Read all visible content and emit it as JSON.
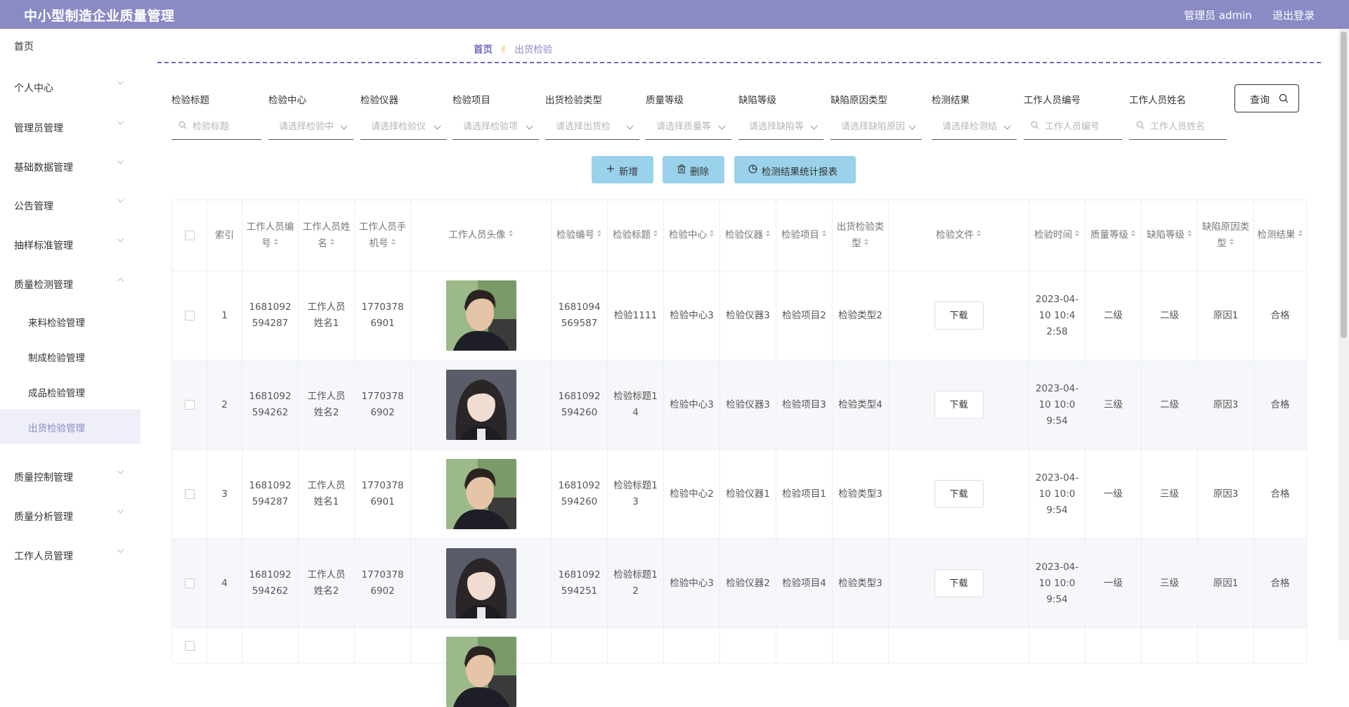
{
  "header": {
    "app_title": "中小型制造企业质量管理",
    "admin_label": "管理员 admin",
    "logout": "退出登录"
  },
  "sidebar": {
    "items": [
      {
        "label": "首页"
      },
      {
        "label": "个人中心"
      },
      {
        "label": "管理员管理"
      },
      {
        "label": "基础数据管理"
      },
      {
        "label": "公告管理"
      },
      {
        "label": "抽样标准管理"
      },
      {
        "label": "质量检测管理"
      },
      {
        "label": "质量控制管理"
      },
      {
        "label": "质量分析管理"
      },
      {
        "label": "工作人员管理"
      }
    ],
    "sub_items": [
      {
        "label": "来料检验管理"
      },
      {
        "label": "制成检验管理"
      },
      {
        "label": "成品检验管理"
      },
      {
        "label": "出货检验管理"
      }
    ]
  },
  "breadcrumb": {
    "home": "首页",
    "separator": "✌",
    "current": "出货检验"
  },
  "filters": [
    {
      "label": "检验标题",
      "placeholder": "检验标题",
      "icon": "search-icon"
    },
    {
      "label": "检验中心",
      "placeholder": "请选择检验中",
      "icon": "chevron-down-icon"
    },
    {
      "label": "检验仪器",
      "placeholder": "请选择检验仪",
      "icon": "chevron-down-icon"
    },
    {
      "label": "检验项目",
      "placeholder": "请选择检验项",
      "icon": "chevron-down-icon"
    },
    {
      "label": "出货检验类型",
      "placeholder": "请选择出货检",
      "icon": "chevron-down-icon"
    },
    {
      "label": "质量等级",
      "placeholder": "请选择质量等",
      "icon": "chevron-down-icon"
    },
    {
      "label": "缺陷等级",
      "placeholder": "请选择缺陷等",
      "icon": "chevron-down-icon"
    },
    {
      "label": "缺陷原因类型",
      "placeholder": "请选择缺陷原因",
      "icon": "chevron-down-icon"
    },
    {
      "label": "检测结果",
      "placeholder": "请选择检测结",
      "icon": "chevron-down-icon"
    },
    {
      "label": "工作人员编号",
      "placeholder": "工作人员编号",
      "icon": "search-icon"
    },
    {
      "label": "工作人员姓名",
      "placeholder": "工作人员姓名",
      "icon": "search-icon"
    }
  ],
  "query_button": "查询",
  "actions": {
    "add": "新增",
    "delete": "删除",
    "report": "检测结果统计报表"
  },
  "table": {
    "headers": [
      "",
      "索引",
      "工作人员编号",
      "工作人员姓名",
      "工作人员手机号",
      "工作人员头像",
      "检验编号",
      "检验标题",
      "检验中心",
      "检验仪器",
      "检验项目",
      "出货检验类型",
      "检验文件",
      "检验时间",
      "质量等级",
      "缺陷等级",
      "缺陷原因类型",
      "检测结果"
    ],
    "download_label": "下载",
    "rows": [
      {
        "index": "1",
        "worker_no": "1681092594287",
        "worker_name": "工作人员姓名1",
        "phone": "17703786901",
        "avatar": "male",
        "insp_no": "1681094569587",
        "title": "检验1111",
        "center": "检验中心3",
        "instrument": "检验仪器3",
        "item": "检验项目2",
        "ship_type": "检验类型2",
        "time": "2023-04-10 10:42:58",
        "quality": "二级",
        "defect": "二级",
        "reason": "原因1",
        "result": "合格"
      },
      {
        "index": "2",
        "worker_no": "1681092594262",
        "worker_name": "工作人员姓名2",
        "phone": "17703786902",
        "avatar": "female",
        "insp_no": "1681092594260",
        "title": "检验标题14",
        "center": "检验中心3",
        "instrument": "检验仪器3",
        "item": "检验项目3",
        "ship_type": "检验类型4",
        "time": "2023-04-10 10:09:54",
        "quality": "三级",
        "defect": "二级",
        "reason": "原因3",
        "result": "合格"
      },
      {
        "index": "3",
        "worker_no": "1681092594287",
        "worker_name": "工作人员姓名1",
        "phone": "17703786901",
        "avatar": "male",
        "insp_no": "1681092594260",
        "title": "检验标题13",
        "center": "检验中心2",
        "instrument": "检验仪器1",
        "item": "检验项目1",
        "ship_type": "检验类型3",
        "time": "2023-04-10 10:09:54",
        "quality": "一级",
        "defect": "三级",
        "reason": "原因3",
        "result": "合格"
      },
      {
        "index": "4",
        "worker_no": "1681092594262",
        "worker_name": "工作人员姓名2",
        "phone": "17703786902",
        "avatar": "female",
        "insp_no": "1681092594251",
        "title": "检验标题12",
        "center": "检验中心3",
        "instrument": "检验仪器2",
        "item": "检验项目4",
        "ship_type": "检验类型3",
        "time": "2023-04-10 10:09:54",
        "quality": "一级",
        "defect": "三级",
        "reason": "原因1",
        "result": "合格"
      },
      {
        "index": "",
        "worker_no": "",
        "worker_name": "",
        "phone": "",
        "avatar": "male",
        "insp_no": "",
        "title": "",
        "center": "",
        "instrument": "",
        "item": "",
        "ship_type": "",
        "time": "",
        "quality": "",
        "defect": "",
        "reason": "",
        "result": ""
      }
    ]
  },
  "colors": {
    "header_bg": "#8a8ac5",
    "active_menu_bg": "#efeff9",
    "action_btn": "#99d2ea",
    "dash_line": "#6a6ab5",
    "row_alt": "#f5f7fa"
  }
}
